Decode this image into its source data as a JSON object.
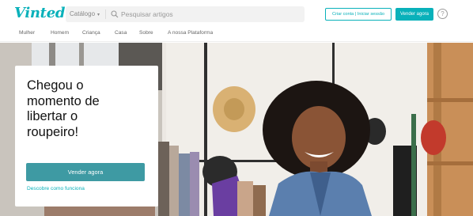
{
  "header": {
    "logo_text": "Vinted",
    "brand_color": "#09b1ba",
    "catalog_label": "Catálogo",
    "catalog_chevron": "▾",
    "search_icon": "search-icon",
    "search_placeholder": "Pesquisar artigos",
    "signup_label": "Criar conta | Iniciar sessão",
    "sell_label": "Vender agora",
    "help_icon": "?"
  },
  "nav": {
    "items": [
      {
        "label": "Mulher"
      },
      {
        "label": "Homem"
      },
      {
        "label": "Criança"
      },
      {
        "label": "Casa"
      },
      {
        "label": "Sobre"
      },
      {
        "label": "A nossa Plataforma"
      }
    ]
  },
  "hero": {
    "headline_lines": [
      "Chegou o",
      "momento de",
      "libertar o",
      "roupeiro!"
    ],
    "cta_label": "Vender agora",
    "howto_link": "Descobre como funciona",
    "cta_color": "#3e9aa3"
  }
}
